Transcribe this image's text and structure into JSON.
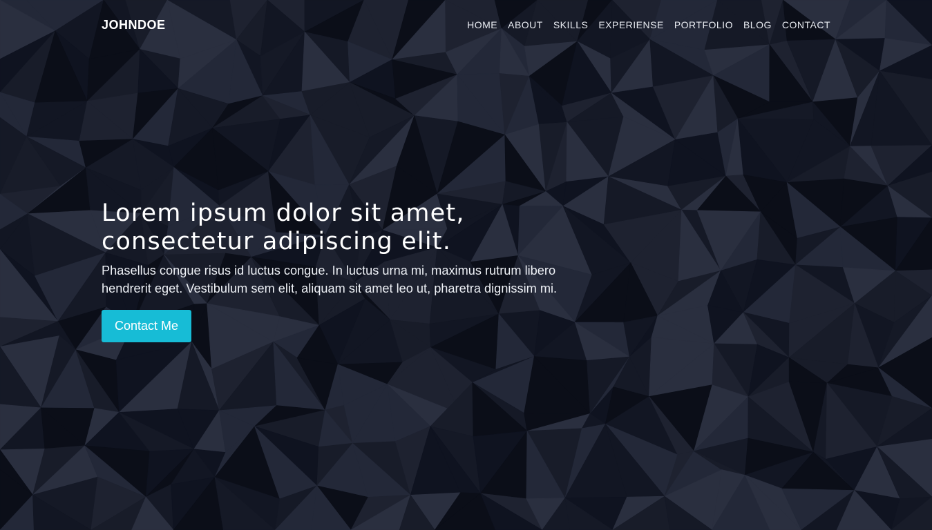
{
  "brand": "JOHNDOE",
  "nav": {
    "items": [
      "HOME",
      "ABOUT",
      "SKILLS",
      "EXPERIENSE",
      "PORTFOLIO",
      "BLOG",
      "CONTACT"
    ]
  },
  "hero": {
    "title_line1": "Lorem ipsum dolor sit amet,",
    "title_line2": "consectetur adipiscing elit.",
    "lead": "Phasellus congue risus id luctus congue. In luctus urna mi, maximus rutrum libero hendrerit eget. Vestibulum sem elit, aliquam sit amet leo ut, pharetra dignissim mi.",
    "cta_label": "Contact Me"
  },
  "colors": {
    "accent": "#17bcd6",
    "background": "#1b1f2b",
    "text": "#ffffff"
  },
  "background_pattern": "low-poly-dark"
}
